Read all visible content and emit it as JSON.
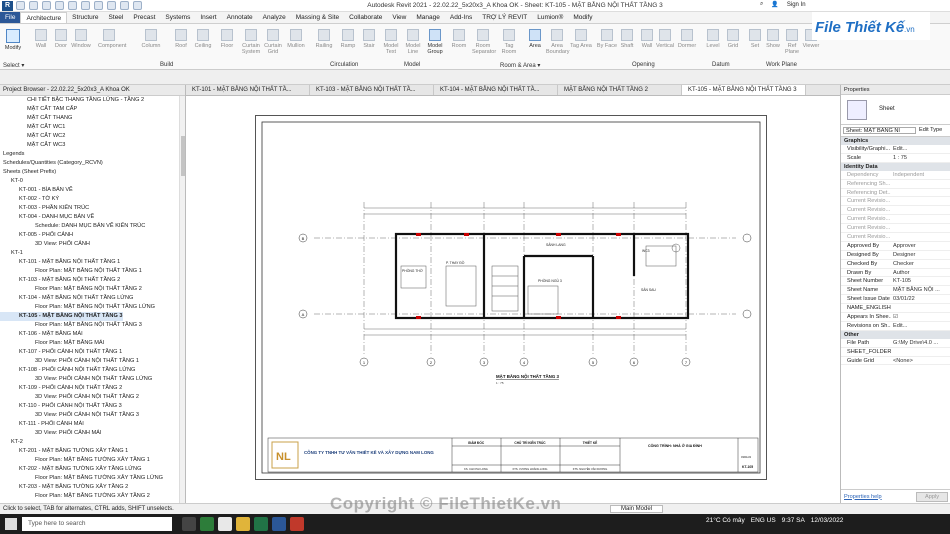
{
  "titlebar": {
    "title": "Autodesk Revit 2021 - 22.02.22_5x20x3_A Khoa OK - Sheet: KT-105 - MẶT BẰNG NỘI THẤT TẦNG 3",
    "sign_in": "Sign In"
  },
  "ribbon_tabs": [
    "File",
    "Architecture",
    "Structure",
    "Steel",
    "Precast",
    "Systems",
    "Insert",
    "Annotate",
    "Analyze",
    "Massing & Site",
    "Collaborate",
    "View",
    "Manage",
    "Add-Ins",
    "TRỢ LÝ REVIT",
    "Lumion®",
    "Modify"
  ],
  "ribbon_tools": [
    "Modify",
    "Wall",
    "Door",
    "Window",
    "Component",
    "Column",
    "Roof",
    "Ceiling",
    "Floor",
    "Curtain System",
    "Curtain Grid",
    "Mullion",
    "Railing",
    "Ramp",
    "Stair",
    "Model Text",
    "Model Line",
    "Model Group",
    "Room",
    "Room Separator",
    "Tag Room",
    "Area",
    "Area Boundary",
    "Tag Area",
    "By Face",
    "Shaft",
    "Wall",
    "Vertical",
    "Dormer",
    "Level",
    "Grid",
    "Set",
    "Show",
    "Ref Plane",
    "Viewer"
  ],
  "ribbon_panels": [
    "Select ▾",
    "Build",
    "Circulation",
    "Model",
    "Room & Area ▾",
    "Opening",
    "Datum",
    "Work Plane"
  ],
  "logo": {
    "text": "File Thiết Kế",
    "domain": ".vn"
  },
  "view_tabs": [
    "KT-101 - MẶT BẰNG NỘI THẤT TẦ...",
    "KT-103 - MẶT BẰNG NỘI THẤT TẦ...",
    "KT-104 - MẶT BẰNG NỘI THẤT TẦ...",
    "MẶT BẰNG NỘI THẤT TẦNG 2",
    "KT-105 - MẶT BẰNG NỘI THẤT TẦNG 3"
  ],
  "browser": {
    "title": "Project Browser - 22.02.22_5x20x3_A Khoa OK",
    "items": [
      {
        "t": "CHI TIẾT BẬC THANG TẦNG LỬNG - TẦNG 2",
        "d": 3
      },
      {
        "t": "MẶT CẮT TAM CẤP",
        "d": 3
      },
      {
        "t": "MẶT CẮT THANG",
        "d": 3
      },
      {
        "t": "MẶT CẮT WC1",
        "d": 3
      },
      {
        "t": "MẶT CẮT WC2",
        "d": 3
      },
      {
        "t": "MẶT CẮT WC3",
        "d": 3
      },
      {
        "t": "Legends",
        "d": 0
      },
      {
        "t": "Schedules/Quantities (Category_RCVN)",
        "d": 0
      },
      {
        "t": "Sheets (Sheet Prefix)",
        "d": 0
      },
      {
        "t": "KT-0",
        "d": 1
      },
      {
        "t": "KT-001 - BÌA BẢN VẼ",
        "d": 2
      },
      {
        "t": "KT-002 - TỜ KÝ",
        "d": 2
      },
      {
        "t": "KT-003 - PHẦN KIẾN TRÚC",
        "d": 2
      },
      {
        "t": "KT-004 - DANH MỤC BẢN VẼ",
        "d": 2
      },
      {
        "t": "Schedule: DANH MỤC BẢN VẼ KIẾN TRÚC",
        "d": 4
      },
      {
        "t": "KT-005 - PHỐI CẢNH",
        "d": 2
      },
      {
        "t": "3D View: PHỐI CẢNH",
        "d": 4
      },
      {
        "t": "KT-1",
        "d": 1
      },
      {
        "t": "KT-101 - MẶT BẰNG NỘI THẤT TẦNG 1",
        "d": 2
      },
      {
        "t": "Floor Plan: MẶT BẰNG NỘI THẤT TẦNG 1",
        "d": 4
      },
      {
        "t": "KT-103 - MẶT BẰNG NỘI THẤT TẦNG 2",
        "d": 2
      },
      {
        "t": "Floor Plan: MẶT BẰNG NỘI THẤT TẦNG 2",
        "d": 4
      },
      {
        "t": "KT-104 - MẶT BẰNG NỘI THẤT TẦNG LỬNG",
        "d": 2
      },
      {
        "t": "Floor Plan: MẶT BẰNG NỘI THẤT TẦNG LỬNG",
        "d": 4
      },
      {
        "t": "KT-105 - MẶT BẰNG NỘI THẤT TẦNG 3",
        "d": 2,
        "sel": true
      },
      {
        "t": "Floor Plan: MẶT BẰNG NỘI THẤT TẦNG 3",
        "d": 4
      },
      {
        "t": "KT-106 - MẶT BẰNG MÁI",
        "d": 2
      },
      {
        "t": "Floor Plan: MẶT BẰNG MÁI",
        "d": 4
      },
      {
        "t": "KT-107 - PHỐI CẢNH NỘI THẤT TẦNG 1",
        "d": 2
      },
      {
        "t": "3D View: PHỐI CẢNH NỘI THẤT TẦNG 1",
        "d": 4
      },
      {
        "t": "KT-108 - PHỐI CẢNH NỘI THẤT TẦNG LỬNG",
        "d": 2
      },
      {
        "t": "3D View: PHỐI CẢNH NỘI THẤT TẦNG LỬNG",
        "d": 4
      },
      {
        "t": "KT-109 - PHỐI CẢNH NỘI THẤT TẦNG 2",
        "d": 2
      },
      {
        "t": "3D View: PHỐI CẢNH NỘI THẤT TẦNG 2",
        "d": 4
      },
      {
        "t": "KT-110 - PHỐI CẢNH NỘI THẤT TẦNG 3",
        "d": 2
      },
      {
        "t": "3D View: PHỐI CẢNH NỘI THẤT TẦNG 3",
        "d": 4
      },
      {
        "t": "KT-111 - PHỐI CẢNH MÁI",
        "d": 2
      },
      {
        "t": "3D View: PHỐI CẢNH MÁI",
        "d": 4
      },
      {
        "t": "KT-2",
        "d": 1
      },
      {
        "t": "KT-201 - MẶT BẰNG TƯỜNG XÂY TẦNG 1",
        "d": 2
      },
      {
        "t": "Floor Plan: MẶT BẰNG TƯỜNG XÂY TẦNG 1",
        "d": 4
      },
      {
        "t": "KT-202 - MẶT BẰNG TƯỜNG XÂY TẦNG LỬNG",
        "d": 2
      },
      {
        "t": "Floor Plan: MẶT BẰNG TƯỜNG XÂY TẦNG LỬNG",
        "d": 4
      },
      {
        "t": "KT-203 - MẶT BẰNG TƯỜNG XÂY TẦNG 2",
        "d": 2
      },
      {
        "t": "Floor Plan: MẶT BẰNG TƯỜNG XÂY TẦNG 2",
        "d": 4
      }
    ]
  },
  "drawing": {
    "plan_title": "MẶT BẰNG NỘI THẤT TẦNG 3",
    "scale": "1 : 75",
    "company": "CÔNG TY TNHH TƯ VẤN THIẾT KẾ VÀ XÂY DỰNG NAM LONG",
    "company_logo": "NL",
    "roles": [
      "GIÁM ĐỐC",
      "CHỦ TRÌ KIẾN TRÚC",
      "THIẾT KẾ"
    ],
    "people": [
      "KS. CAO PHI LONG",
      "KTS. VƯƠNG HOÀNG LONG",
      "KTS. NGUYỄN VĂN DƯƠNG"
    ],
    "project_label": "CÔNG TRÌNH: NHÀ Ở GIA ĐÌNH",
    "sheet_no": "KT-105",
    "date": "03/01/22",
    "rooms": [
      "PHÒNG THỜ",
      "P. THAY ĐỒ",
      "PHÒNG NGỦ 3",
      "SẢNH LANG",
      "WC3",
      "SÂN SAU"
    ],
    "grids": [
      "B",
      "A",
      "1",
      "2",
      "3",
      "4",
      "5",
      "6",
      "7"
    ]
  },
  "props": {
    "title": "Properties",
    "family": "Sheet",
    "type_selector": "Sheet: MẶT BẰNG NI",
    "edit_type": "Edit Type",
    "help": "Properties help",
    "apply": "Apply",
    "groups": [
      {
        "name": "Graphics",
        "rows": [
          [
            "Visibility/Graphi...",
            "Edit..."
          ],
          [
            "Scale",
            "1 : 75"
          ]
        ]
      },
      {
        "name": "Identity Data",
        "rows": [
          [
            "Dependency",
            "Independent"
          ],
          [
            "Referencing Sh...",
            ""
          ],
          [
            "Referencing Det...",
            ""
          ],
          [
            "Current Revisio...",
            ""
          ],
          [
            "Current Revisio...",
            ""
          ],
          [
            "Current Revisio...",
            ""
          ],
          [
            "Current Revisio...",
            ""
          ],
          [
            "Current Revisio...",
            ""
          ],
          [
            "Approved By",
            "Approver"
          ],
          [
            "Designed By",
            "Designer"
          ],
          [
            "Checked By",
            "Checker"
          ],
          [
            "Drawn By",
            "Author"
          ],
          [
            "Sheet Number",
            "KT-105"
          ],
          [
            "Sheet Name",
            "MẶT BẰNG NỘI ..."
          ],
          [
            "Sheet Issue Date",
            "03/01/22"
          ],
          [
            "NAME_ENGLISH",
            ""
          ],
          [
            "Appears In Shee...",
            "☑"
          ],
          [
            "Revisions on Sh...",
            "Edit..."
          ]
        ]
      },
      {
        "name": "Other",
        "rows": [
          [
            "File Path",
            "G:\\My Drive\\4.0 ..."
          ],
          [
            "SHEET_FOLDER",
            ""
          ],
          [
            "Guide Grid",
            "<None>"
          ]
        ]
      }
    ]
  },
  "status": {
    "hint": "Click to select, TAB for alternates, CTRL adds, SHIFT unselects.",
    "model": "Main Model"
  },
  "taskbar": {
    "search": "Type here to search",
    "weather": "21°C Có mây",
    "lang": "ENG US",
    "time": "9:37 SA",
    "date": "12/03/2022"
  },
  "watermark": "Copyright © FileThietKe.vn"
}
